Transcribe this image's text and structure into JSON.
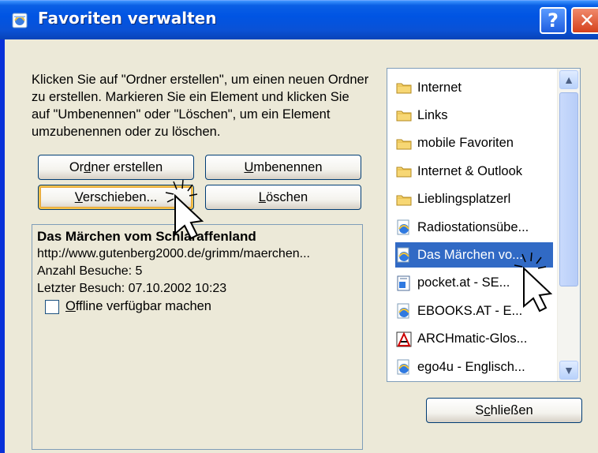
{
  "window": {
    "title": "Favoriten verwalten",
    "help_glyph": "?",
    "close_glyph": "✕"
  },
  "instructions": "Klicken Sie auf \"Ordner erstellen\", um einen neuen Ordner zu erstellen. Markieren Sie ein Element und klicken Sie auf \"Umbenennen\" oder \"Löschen\", um ein Element umzubenennen oder zu löschen.",
  "buttons": {
    "create_folder_pre": "Or",
    "create_folder_acc": "d",
    "create_folder_post": "ner erstellen",
    "rename_acc": "U",
    "rename_post": "mbenennen",
    "move_acc": "V",
    "move_post": "erschieben...",
    "delete_acc": "L",
    "delete_post": "öschen",
    "close_pre": "S",
    "close_acc": "c",
    "close_post": "hließen"
  },
  "details": {
    "title": "Das Märchen vom Schlaraffenland",
    "url": "http://www.gutenberg2000.de/grimm/maerchen...",
    "visits": "Anzahl Besuche: 5",
    "last_visit": "Letzter Besuch: 07.10.2002 10:23",
    "offline_acc": "O",
    "offline_post": "ffline verfügbar machen",
    "offline_checked": false
  },
  "favorites": [
    {
      "label": "Internet",
      "icon": "folder-icon"
    },
    {
      "label": "Links",
      "icon": "folder-icon"
    },
    {
      "label": "mobile Favoriten",
      "icon": "folder-icon"
    },
    {
      "label": "Internet & Outlook",
      "icon": "folder-icon"
    },
    {
      "label": "Lieblingsplatzerl",
      "icon": "folder-icon"
    },
    {
      "label": "Radiostationsübe...",
      "icon": "ie-page-icon"
    },
    {
      "label": "Das Märchen vo...",
      "icon": "ie-page-icon",
      "selected": true
    },
    {
      "label": "pocket.at - SE...",
      "icon": "page-icon"
    },
    {
      "label": "EBOOKS.AT - E...",
      "icon": "ie-page-icon"
    },
    {
      "label": "ARCHmatic-Glos...",
      "icon": "archmatic-icon"
    },
    {
      "label": "ego4u - Englisch...",
      "icon": "ie-page-icon"
    }
  ],
  "colors": {
    "titlebar": "#0054e3",
    "selection": "#316ac5",
    "dialog_bg": "#ece9d8"
  }
}
